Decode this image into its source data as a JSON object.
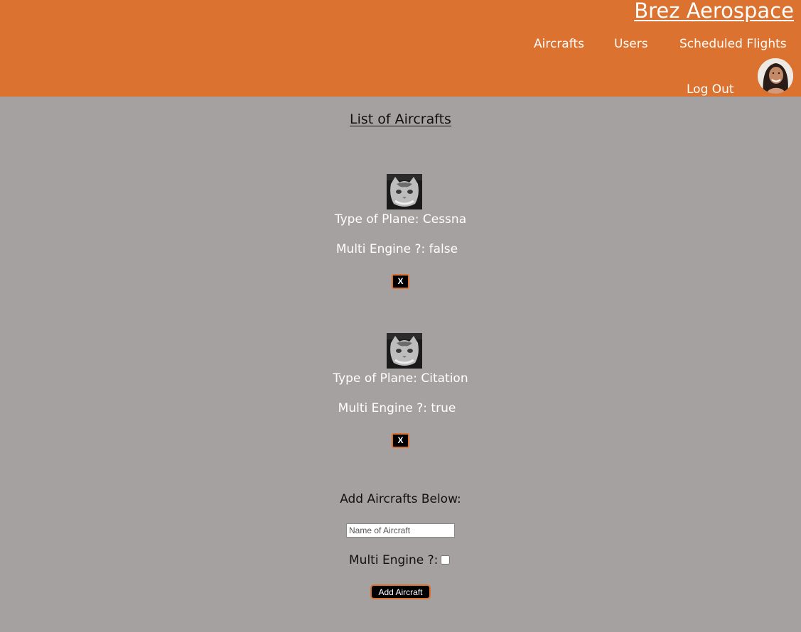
{
  "header": {
    "brand": "Brez Aerospace",
    "nav": [
      {
        "label": "Aircrafts"
      },
      {
        "label": "Users"
      },
      {
        "label": "Scheduled Flights"
      }
    ],
    "logout_label": "Log Out",
    "accent_color": "#db7230"
  },
  "main": {
    "title": "List of Aircrafts",
    "aircrafts": [
      {
        "type_line": "Type of Plane: Cessna",
        "engine_line": "Multi Engine ?: false",
        "delete_label": "X"
      },
      {
        "type_line": "Type of Plane: Citation",
        "engine_line": "Multi Engine ?: true",
        "delete_label": "X"
      }
    ],
    "add_form": {
      "heading": "Add Aircrafts Below:",
      "name_placeholder": "Name of Aircraft",
      "name_value": "",
      "multi_engine_label": "Multi Engine ?:",
      "multi_engine_checked": false,
      "submit_label": "Add Aircraft"
    }
  },
  "colors": {
    "page_background": "#a5a1a0",
    "header_background": "#db7230",
    "button_background": "#000000"
  }
}
